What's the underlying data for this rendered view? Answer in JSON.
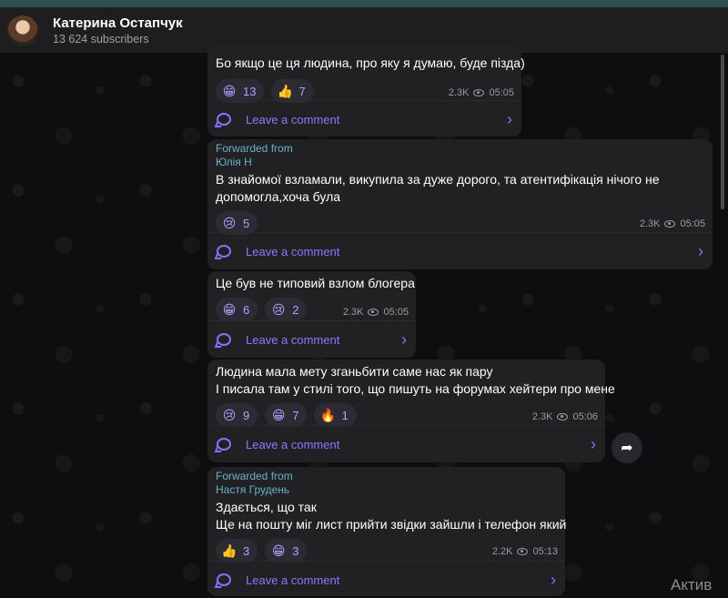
{
  "header": {
    "title": "Катерина Остапчук",
    "subtitle": "13 624 subscribers"
  },
  "comment_label": "Leave a comment",
  "watermark": "Актив",
  "messages": [
    {
      "text_lines": [
        "Бо якщо це ця людина, про яку я думаю, буде пізда)"
      ],
      "reactions": [
        {
          "emoji": "grin-emoji",
          "count": "13"
        },
        {
          "emoji": "thumbs-up-emoji",
          "count": "7"
        }
      ],
      "views": "2.3K",
      "time": "05:05"
    },
    {
      "forwarded_label": "Forwarded from",
      "forwarded_name": "Юлія Н",
      "text_lines": [
        "В знайомої взламали, викупила за дуже дорого, та атентифікація нічого не",
        "допомогла,хоча була"
      ],
      "reactions": [
        {
          "emoji": "cry-emoji",
          "count": "5"
        }
      ],
      "views": "2.3K",
      "time": "05:05"
    },
    {
      "text_lines": [
        "Це був не типовий взлом блогера"
      ],
      "reactions": [
        {
          "emoji": "grin-emoji",
          "count": "6"
        },
        {
          "emoji": "cry-emoji",
          "count": "2"
        }
      ],
      "views": "2.3K",
      "time": "05:05"
    },
    {
      "text_lines": [
        "Людина мала мету зганьбити саме нас як пару",
        "І писала там у стилі того, що пишуть на форумах хейтери про мене"
      ],
      "reactions": [
        {
          "emoji": "cry-emoji",
          "count": "9"
        },
        {
          "emoji": "grin-emoji",
          "count": "7"
        },
        {
          "emoji": "fire-emoji",
          "count": "1"
        }
      ],
      "views": "2.3K",
      "time": "05:06"
    },
    {
      "forwarded_label": "Forwarded from",
      "forwarded_name": "Настя Грудень",
      "text_lines": [
        "Здається, що так",
        "Ще на пошту міг лист прийти звідки зайшли і телефон який"
      ],
      "reactions": [
        {
          "emoji": "thumbs-up-emoji",
          "count": "3"
        },
        {
          "emoji": "grin-emoji",
          "count": "3"
        }
      ],
      "views": "2.2K",
      "time": "05:13"
    }
  ]
}
